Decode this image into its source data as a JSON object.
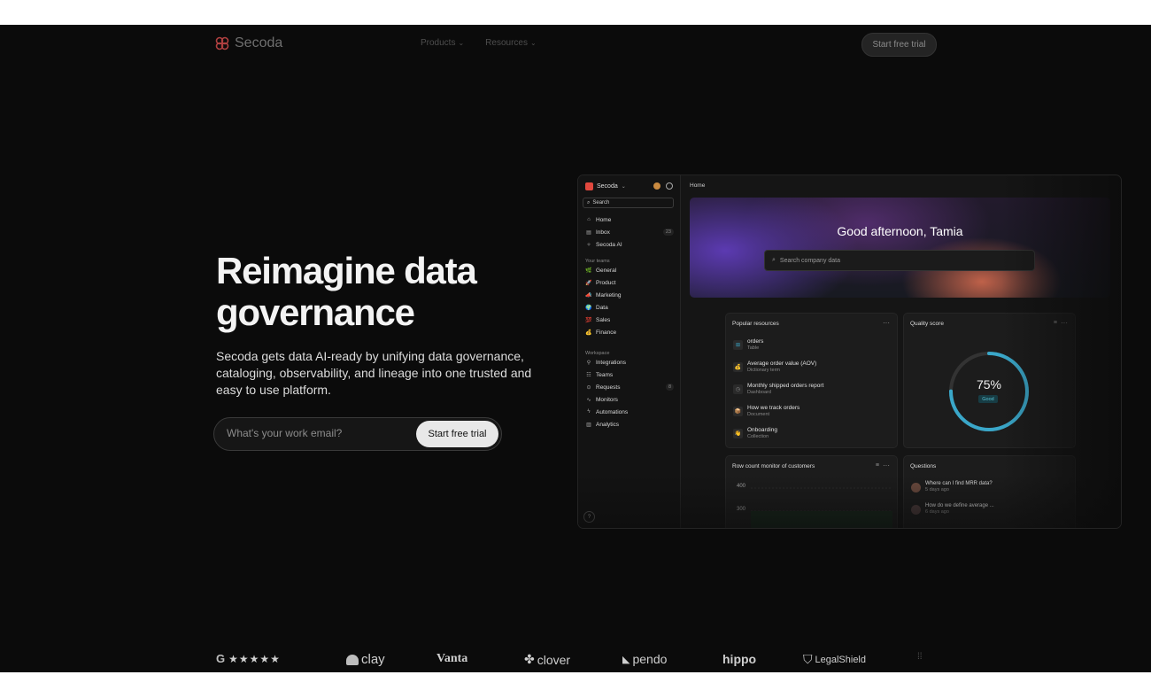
{
  "nav": {
    "brand": "Secoda",
    "menu": [
      {
        "label": "Products"
      },
      {
        "label": "Resources"
      }
    ],
    "cta": "Start free trial"
  },
  "hero": {
    "title": "Reimagine data governance",
    "subtitle": "Secoda gets data AI-ready by unifying data governance, cataloging, observability, and lineage into one trusted and easy to use platform.",
    "email_placeholder": "What's your work email?",
    "cta": "Start free trial"
  },
  "app": {
    "workspace": "Secoda",
    "search": "Search",
    "nav": [
      {
        "label": "Home",
        "icon": "home-icon",
        "glyph": "⌂"
      },
      {
        "label": "Inbox",
        "icon": "inbox-icon",
        "glyph": "▤",
        "count": "23"
      },
      {
        "label": "Secoda AI",
        "icon": "sparkle-icon",
        "glyph": "✧"
      }
    ],
    "teams_label": "Your teams",
    "teams": [
      {
        "label": "General",
        "glyph": "🌿"
      },
      {
        "label": "Product",
        "glyph": "🚀"
      },
      {
        "label": "Marketing",
        "glyph": "📣"
      },
      {
        "label": "Data",
        "glyph": "🌍"
      },
      {
        "label": "Sales",
        "glyph": "💯"
      },
      {
        "label": "Finance",
        "glyph": "💰"
      }
    ],
    "workspace_label": "Workspace",
    "workspace_items": [
      {
        "label": "Integrations",
        "glyph": "⚲"
      },
      {
        "label": "Teams",
        "glyph": "☷"
      },
      {
        "label": "Requests",
        "glyph": "⊙",
        "count": "8"
      },
      {
        "label": "Monitors",
        "glyph": "∿"
      },
      {
        "label": "Automations",
        "glyph": "ϟ"
      },
      {
        "label": "Analytics",
        "glyph": "▥"
      }
    ],
    "help": "?",
    "breadcrumb": "Home",
    "greeting": "Good afternoon, Tamia",
    "company_search": "Search company data",
    "popular": {
      "title": "Popular resources",
      "items": [
        {
          "name": "orders",
          "type": "Table",
          "glyph": "⊞",
          "color": "#3aa7c9"
        },
        {
          "name": "Average order value (AOV)",
          "type": "Dictionary term",
          "glyph": "💰",
          "color": "#e0b040"
        },
        {
          "name": "Monthly shipped orders report",
          "type": "Dashboard",
          "glyph": "◷",
          "color": "#888888"
        },
        {
          "name": "How we track orders",
          "type": "Document",
          "glyph": "📦",
          "color": "#c98a40"
        },
        {
          "name": "Onboarding",
          "type": "Collection",
          "glyph": "👋",
          "color": "#e0b040"
        }
      ]
    },
    "quality": {
      "title": "Quality score",
      "value": "75%",
      "fraction": 0.75,
      "badge": "Good"
    },
    "rowcount": {
      "title": "Row count monitor of customers",
      "ticks": [
        "400",
        "300"
      ]
    },
    "questions": {
      "title": "Questions",
      "items": [
        {
          "text": "Where can I find MRR data?",
          "time": "5 days ago"
        },
        {
          "text": "How do we define average ...",
          "time": "6 days ago"
        }
      ]
    }
  },
  "logos": {
    "rating_badge": "G",
    "stars": "★★★★★",
    "brands": [
      "clay",
      "Vanta",
      "clover",
      "pendo",
      "hippo",
      "LegalShield"
    ]
  },
  "colors": {
    "background": "#0b0b0b",
    "accent_gauge": "#3aa7c9",
    "brand_red": "#e0483e"
  }
}
